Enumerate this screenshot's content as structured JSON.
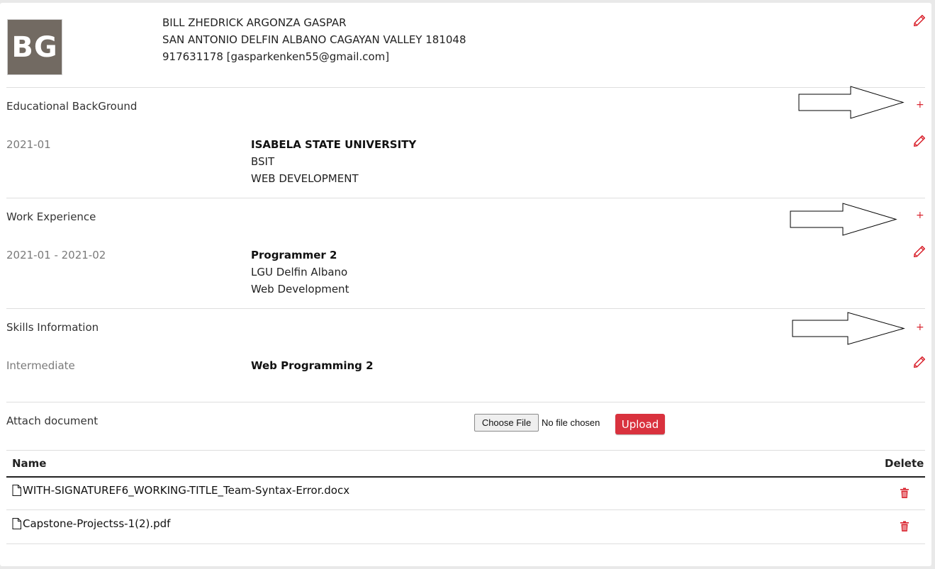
{
  "profile": {
    "initials": "BG",
    "name": "BILL ZHEDRICK ARGONZA GASPAR",
    "address": "SAN ANTONIO DELFIN ALBANO CAGAYAN VALLEY 181048",
    "contact": "917631178 [gasparkenken55@gmail.com]"
  },
  "education": {
    "title": "Educational BackGround",
    "entry": {
      "date": "2021-01",
      "school": "ISABELA STATE UNIVERSITY",
      "course": "BSIT",
      "major": "WEB DEVELOPMENT"
    }
  },
  "work": {
    "title": "Work Experience",
    "entry": {
      "date": "2021-01 - 2021-02",
      "position": "Programmer 2",
      "company": "LGU Delfin Albano",
      "field": "Web Development"
    }
  },
  "skills": {
    "title": "Skills Information",
    "entry": {
      "level": "Intermediate",
      "skill": "Web Programming 2"
    }
  },
  "attach": {
    "label": "Attach document",
    "choose_label": "Choose File",
    "no_file": "No file chosen",
    "upload_label": "Upload"
  },
  "files_table": {
    "col_name": "Name",
    "col_delete": "Delete",
    "rows": [
      {
        "name": "WITH-SIGNATUREF6_WORKING-TITLE_Team-Syntax-Error.docx"
      },
      {
        "name": "Capstone-Projectss-1(2).pdf"
      }
    ]
  },
  "icons": {
    "add": "+",
    "edit": "pencil-icon",
    "delete": "trash-icon",
    "file": "file-icon",
    "annotation": "arrow-right-icon"
  },
  "colors": {
    "accent": "#d9232e",
    "upload_bg": "#d9323e",
    "avatar_bg": "#726a62"
  }
}
